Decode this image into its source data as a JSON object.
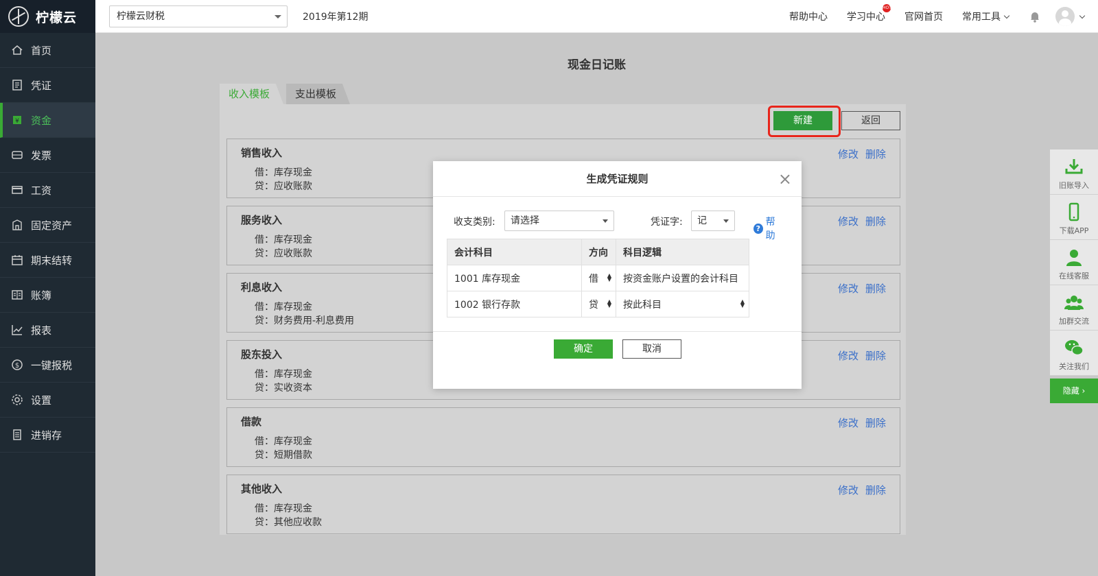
{
  "app": {
    "name": "柠檬云"
  },
  "sidebar": {
    "items": [
      {
        "label": "首页",
        "icon": "home-icon"
      },
      {
        "label": "凭证",
        "icon": "voucher-icon"
      },
      {
        "label": "资金",
        "icon": "fund-icon",
        "active": true
      },
      {
        "label": "发票",
        "icon": "invoice-icon"
      },
      {
        "label": "工资",
        "icon": "salary-icon"
      },
      {
        "label": "固定资产",
        "icon": "asset-icon"
      },
      {
        "label": "期末结转",
        "icon": "calendar-icon"
      },
      {
        "label": "账簿",
        "icon": "ledger-icon"
      },
      {
        "label": "报表",
        "icon": "chart-icon"
      },
      {
        "label": "一键报税",
        "icon": "tax-icon"
      },
      {
        "label": "设置",
        "icon": "gear-icon"
      },
      {
        "label": "进销存",
        "icon": "inventory-icon"
      }
    ]
  },
  "header": {
    "company": "柠檬云财税",
    "period": "2019年第12期",
    "links": {
      "help": "帮助中心",
      "learn": "学习中心",
      "learn_badge": "HOT",
      "home": "官网首页",
      "tools": "常用工具"
    }
  },
  "main": {
    "title": "现金日记账",
    "tabs": {
      "income": "收入模板",
      "expense": "支出模板"
    },
    "buttons": {
      "new": "新建",
      "back": "返回"
    },
    "actions": {
      "edit": "修改",
      "delete": "删除"
    },
    "cards": [
      {
        "title": "销售收入",
        "debit": "借：库存现金",
        "credit": "贷：应收账款"
      },
      {
        "title": "服务收入",
        "debit": "借：库存现金",
        "credit": "贷：应收账款"
      },
      {
        "title": "利息收入",
        "debit": "借：库存现金",
        "credit": "贷：财务费用-利息费用"
      },
      {
        "title": "股东投入",
        "debit": "借：库存现金",
        "credit": "贷：实收资本"
      },
      {
        "title": "借款",
        "debit": "借：库存现金",
        "credit": "贷：短期借款"
      },
      {
        "title": "其他收入",
        "debit": "借：库存现金",
        "credit": "贷：其他应收款"
      }
    ]
  },
  "floatbar": {
    "items": [
      "旧账导入",
      "下载APP",
      "在线客服",
      "加群交流",
      "关注我们"
    ],
    "hide": "隐藏 ›"
  },
  "modal": {
    "title": "生成凭证规则",
    "close": "×",
    "category_label": "收支类别:",
    "category_value": "请选择",
    "voucher_label": "凭证字:",
    "voucher_value": "记",
    "help": "帮助",
    "columns": [
      "会计科目",
      "方向",
      "科目逻辑"
    ],
    "rows": [
      {
        "account": "1001 库存现金",
        "direction": "借",
        "logic": "按资金账户设置的会计科目"
      },
      {
        "account": "1002 银行存款",
        "direction": "贷",
        "logic": "按此科目"
      }
    ],
    "ok": "确定",
    "cancel": "取消"
  },
  "colors": {
    "brand_green": "#3aaa35",
    "link_blue": "#3a6fc9",
    "highlight_red": "#e8251b",
    "sidebar_bg": "#1f2a33"
  }
}
